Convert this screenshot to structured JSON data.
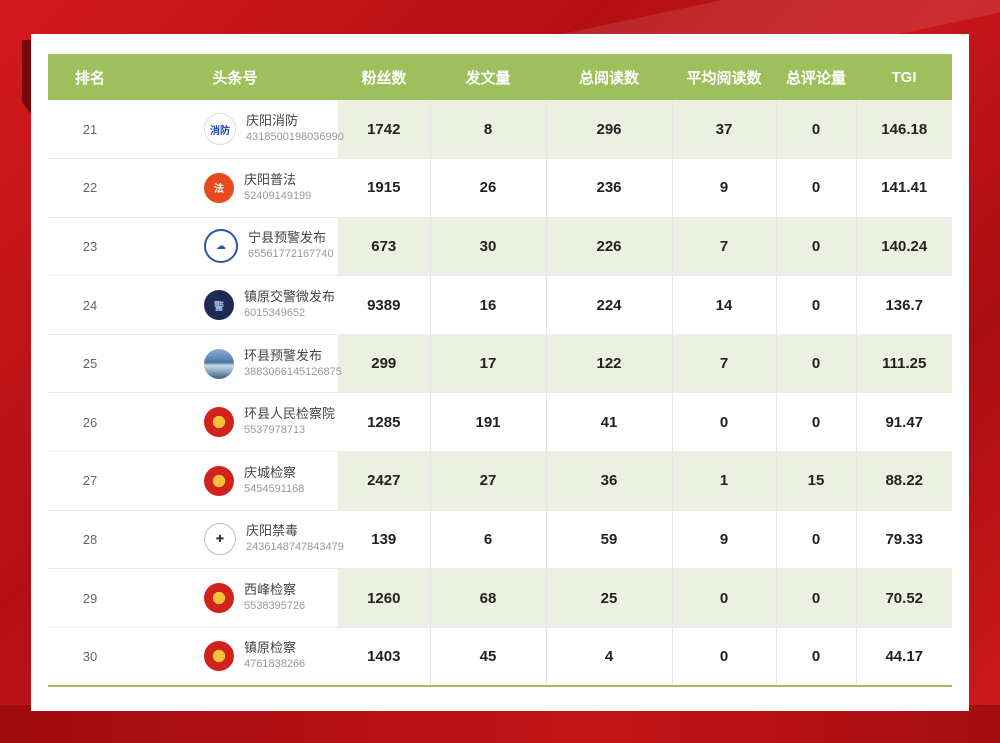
{
  "headers": [
    "排名",
    "头条号",
    "粉丝数",
    "发文量",
    "总阅读数",
    "平均阅读数",
    "总评论量",
    "TGI"
  ],
  "rows": [
    {
      "rank": "21",
      "name": "庆阳消防",
      "id": "4318500198036990",
      "logo": "fire-dept-logo",
      "fans": "1742",
      "posts": "8",
      "reads": "296",
      "avg": "37",
      "comments": "0",
      "tgi": "146.18"
    },
    {
      "rank": "22",
      "name": "庆阳普法",
      "id": "52409149199",
      "logo": "law-logo",
      "fans": "1915",
      "posts": "26",
      "reads": "236",
      "avg": "9",
      "comments": "0",
      "tgi": "141.41"
    },
    {
      "rank": "23",
      "name": "宁县预警发布",
      "id": "65561772167740",
      "logo": "weather-logo",
      "fans": "673",
      "posts": "30",
      "reads": "226",
      "avg": "7",
      "comments": "0",
      "tgi": "140.24"
    },
    {
      "rank": "24",
      "name": "镇原交警微发布",
      "id": "6015349652",
      "logo": "police-logo",
      "fans": "9389",
      "posts": "16",
      "reads": "224",
      "avg": "14",
      "comments": "0",
      "tgi": "136.7"
    },
    {
      "rank": "25",
      "name": "环县预警发布",
      "id": "3883066145126875",
      "logo": "sky-photo",
      "fans": "299",
      "posts": "17",
      "reads": "122",
      "avg": "7",
      "comments": "0",
      "tgi": "111.25"
    },
    {
      "rank": "26",
      "name": "环县人民检察院",
      "id": "5537978713",
      "logo": "procuratorate-emblem",
      "fans": "1285",
      "posts": "191",
      "reads": "41",
      "avg": "0",
      "comments": "0",
      "tgi": "91.47"
    },
    {
      "rank": "27",
      "name": "庆城检察",
      "id": "5454591168",
      "logo": "procuratorate-emblem",
      "fans": "2427",
      "posts": "27",
      "reads": "36",
      "avg": "1",
      "comments": "15",
      "tgi": "88.22"
    },
    {
      "rank": "28",
      "name": "庆阳禁毒",
      "id": "2436148747843479",
      "logo": "anti-drug-logo",
      "fans": "139",
      "posts": "6",
      "reads": "59",
      "avg": "9",
      "comments": "0",
      "tgi": "79.33"
    },
    {
      "rank": "29",
      "name": "西峰检察",
      "id": "5538395726",
      "logo": "procuratorate-emblem",
      "fans": "1260",
      "posts": "68",
      "reads": "25",
      "avg": "0",
      "comments": "0",
      "tgi": "70.52"
    },
    {
      "rank": "30",
      "name": "镇原检察",
      "id": "4761838266",
      "logo": "procuratorate-emblem",
      "fans": "1403",
      "posts": "45",
      "reads": "4",
      "avg": "0",
      "comments": "0",
      "tgi": "44.17"
    }
  ],
  "colors": {
    "header": "#9dbf5c",
    "stripe": "#ebf0e0",
    "frame": "#c8161a"
  }
}
